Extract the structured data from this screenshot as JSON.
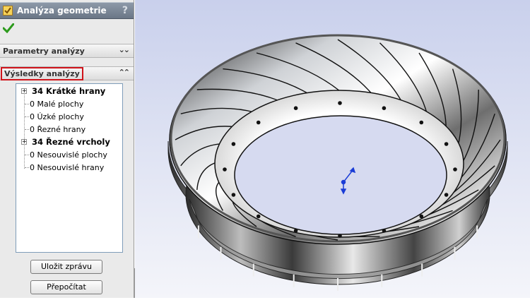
{
  "panel": {
    "title": "Analýza geometrie",
    "help": "?",
    "sections": {
      "parameters": "Parametry analýzy",
      "results": "Výsledky analýzy"
    },
    "results": [
      {
        "label": "34 Krátké hrany",
        "bold": true,
        "expandable": true
      },
      {
        "label": "0 Malé plochy",
        "bold": false,
        "expandable": false
      },
      {
        "label": "0 Úzké plochy",
        "bold": false,
        "expandable": false
      },
      {
        "label": "0 Řezné hrany",
        "bold": false,
        "expandable": false
      },
      {
        "label": "34 Řezné vrcholy",
        "bold": true,
        "expandable": true
      },
      {
        "label": "0 Nesouvislé plochy",
        "bold": false,
        "expandable": false
      },
      {
        "label": "0 Nesouvislé hrany",
        "bold": false,
        "expandable": false
      }
    ],
    "buttons": {
      "save": "Uložit zprávu",
      "recalc": "Přepočítat"
    }
  },
  "colors": {
    "accent_highlight": "#d0141b",
    "ok_check": "#2c9a1c",
    "triad": "#1a3cd6"
  },
  "viewport": {
    "model": "turbine-ring-model",
    "blade_count": 24,
    "bolt_hole_count": 16
  }
}
